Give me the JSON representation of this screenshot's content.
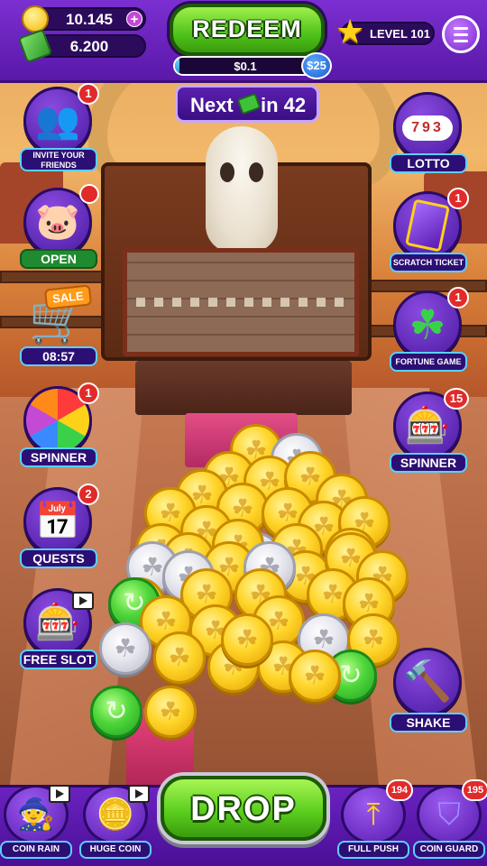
{
  "hud": {
    "gold_amount": "10.145",
    "cash_amount": "6.200",
    "add_symbol": "+",
    "redeem_label": "REDEEM",
    "progress_text": "$0.1",
    "progress_fraction": 0.004,
    "goal_badge": "$25",
    "level_label": "LEVEL 101",
    "next_prefix": "Next",
    "next_suffix": "in 42"
  },
  "left_buttons": [
    {
      "label": "INVITE YOUR FRIENDS",
      "badge": "1",
      "icon": "friends-icon"
    },
    {
      "label": "OPEN",
      "badge": "",
      "icon": "piggy-bank-icon"
    },
    {
      "label": "08:57",
      "sale": "SALE",
      "icon": "shopping-cart-icon"
    },
    {
      "label": "SPINNER",
      "badge": "1",
      "icon": "wheel-icon"
    },
    {
      "label": "QUESTS",
      "badge": "2",
      "icon": "calendar-check-icon"
    },
    {
      "label": "FREE SLOT",
      "badge": "",
      "icon": "slot-machine-icon"
    }
  ],
  "right_buttons": [
    {
      "label": "LOTTO",
      "badge": "",
      "balls": "793",
      "icon": "lotto-machine-icon"
    },
    {
      "label": "SCRATCH TICKET",
      "badge": "1",
      "icon": "scratch-ticket-icon"
    },
    {
      "label": "FORTUNE GAME",
      "badge": "1",
      "icon": "clover-icon"
    },
    {
      "label": "SPINNER",
      "badge": "15",
      "icon": "slot-machine-icon"
    },
    {
      "label": "SHAKE",
      "badge": "",
      "icon": "hammer-icon"
    }
  ],
  "bottom": {
    "drop_label": "DROP",
    "coin_rain_label": "COIN RAIN",
    "huge_coin_label": "HUGE COIN",
    "full_push_label": "FULL PUSH",
    "full_push_badge": "194",
    "coin_guard_label": "COIN GUARD",
    "coin_guard_badge": "195"
  },
  "colors": {
    "hud_purple": "#5a18a8",
    "button_green": "#4fc21a",
    "badge_red": "#e12a2a",
    "label_border_cyan": "#5ad0ff"
  }
}
